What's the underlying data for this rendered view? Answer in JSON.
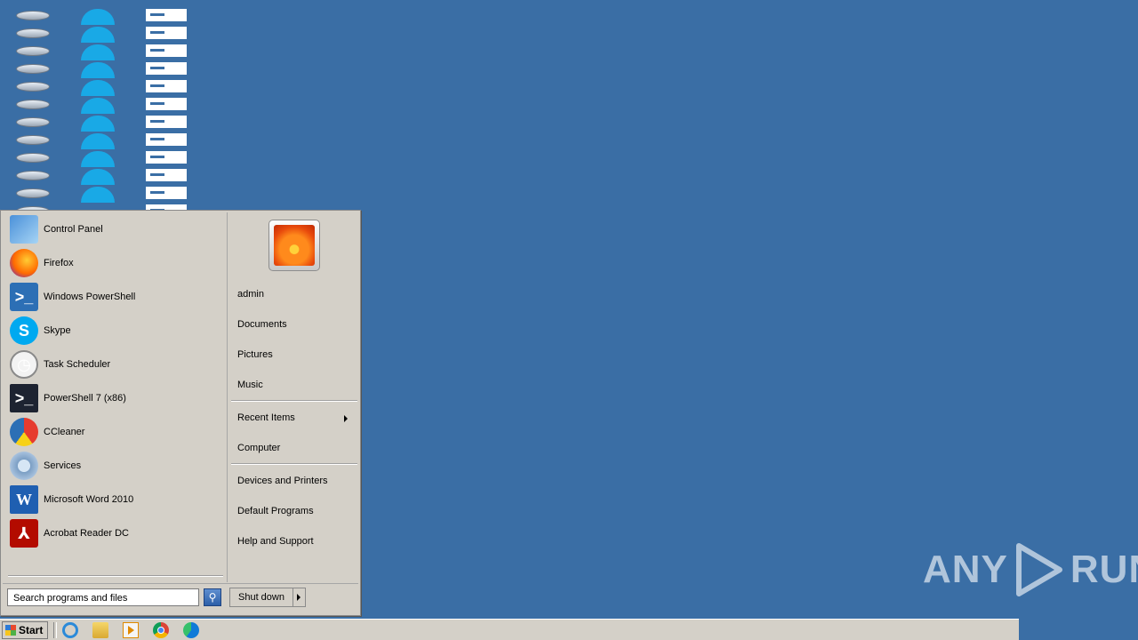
{
  "desktop": {
    "icon_types": [
      "drive-icon",
      "ie-icon",
      "document-icon"
    ]
  },
  "start_menu": {
    "programs": [
      {
        "label": "Control Panel",
        "icon": "control-panel-icon"
      },
      {
        "label": "Firefox",
        "icon": "firefox-icon"
      },
      {
        "label": "Windows PowerShell",
        "icon": "powershell-icon"
      },
      {
        "label": "Skype",
        "icon": "skype-icon"
      },
      {
        "label": "Task Scheduler",
        "icon": "clock-icon"
      },
      {
        "label": "PowerShell 7 (x86)",
        "icon": "powershell7-icon"
      },
      {
        "label": "CCleaner",
        "icon": "ccleaner-icon"
      },
      {
        "label": "Services",
        "icon": "gears-icon"
      },
      {
        "label": "Microsoft Word 2010",
        "icon": "word-icon"
      },
      {
        "label": "Acrobat Reader DC",
        "icon": "acrobat-icon"
      }
    ],
    "right_items": {
      "user": "admin",
      "documents": "Documents",
      "pictures": "Pictures",
      "music": "Music",
      "recent_items": "Recent Items",
      "computer": "Computer",
      "devices": "Devices and Printers",
      "default_programs": "Default Programs",
      "help": "Help and Support"
    },
    "search": {
      "placeholder": "Search programs and files"
    },
    "shutdown_label": "Shut down"
  },
  "taskbar": {
    "start_label": "Start",
    "pinned": [
      "internet-explorer-icon",
      "file-explorer-icon",
      "media-player-icon",
      "chrome-icon",
      "edge-icon"
    ]
  },
  "watermark": {
    "left": "ANY",
    "right": "RUN"
  }
}
